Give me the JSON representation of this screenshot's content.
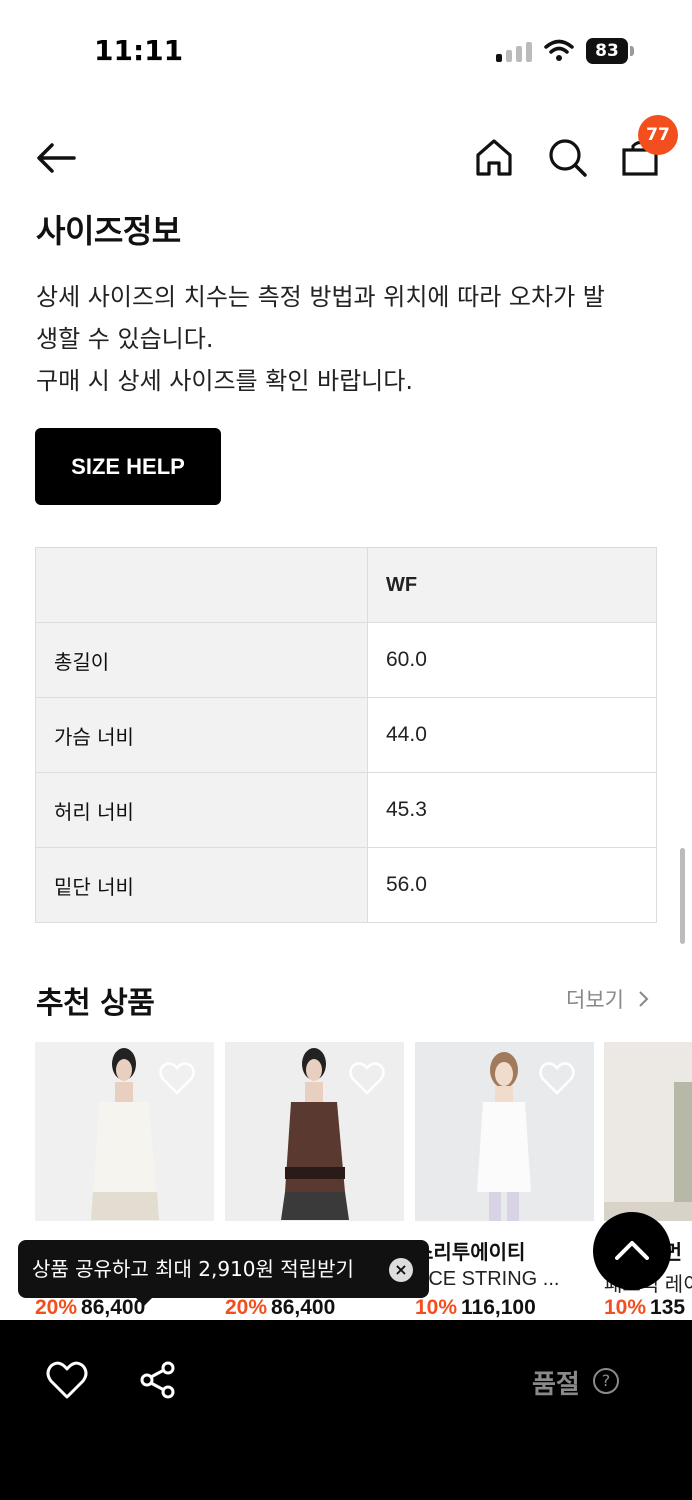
{
  "status_bar": {
    "time": "11:11",
    "battery": "83"
  },
  "nav": {
    "bag_count": "77"
  },
  "size_info": {
    "title": "사이즈정보",
    "description": [
      "상세 사이즈의 치수는 측정 방법과 위치에 따라 오차가 발",
      "생할 수 있습니다.",
      "구매 시 상세 사이즈를 확인 바랍니다."
    ],
    "help_button": "SIZE HELP",
    "table": {
      "header": [
        "",
        "WF"
      ],
      "rows": [
        {
          "label": "총길이",
          "value": "60.0"
        },
        {
          "label": "가슴 너비",
          "value": "44.0"
        },
        {
          "label": "허리 너비",
          "value": "45.3"
        },
        {
          "label": "밑단 너비",
          "value": "56.0"
        }
      ]
    }
  },
  "recommended": {
    "title": "추천 상품",
    "more": "더보기",
    "products": [
      {
        "brand": "",
        "name": "",
        "discount": "20%",
        "price": "86,400"
      },
      {
        "brand": "",
        "name": "",
        "discount": "20%",
        "price": "86,400"
      },
      {
        "brand": "스리투에이티",
        "name": "ACE STRING ...",
        "discount": "10%",
        "price": "116,100"
      },
      {
        "brand": "먼",
        "name": "패브릭 레이",
        "discount": "10%",
        "price": "135"
      }
    ]
  },
  "toast": {
    "text": "상품 공유하고 최대 2,910원 적립받기"
  },
  "bottom_bar": {
    "status": "품절",
    "help": "?"
  }
}
